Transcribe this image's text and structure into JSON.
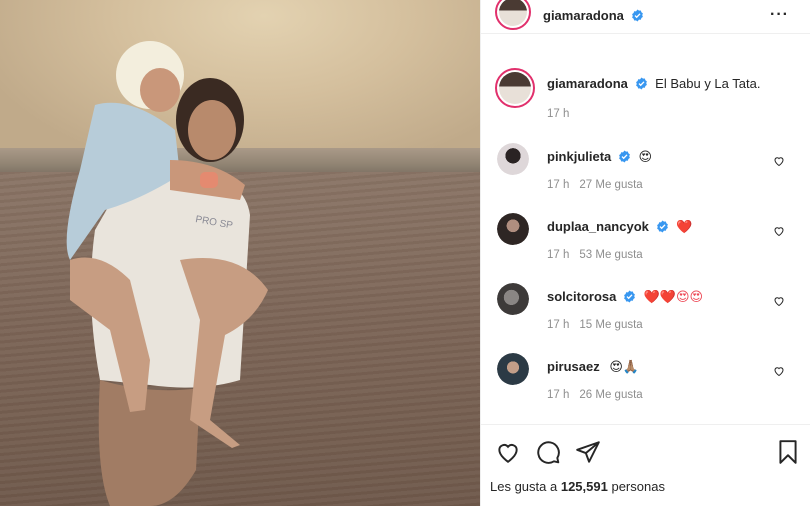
{
  "post": {
    "author": "giamaradona",
    "caption": "El Babu y La Tata.",
    "time": "17 h"
  },
  "comments": [
    {
      "user": "pinkjulieta",
      "text": "😍",
      "time": "17 h",
      "likes": "27 Me gusta"
    },
    {
      "user": "duplaa_nancyok",
      "text": "❤️",
      "time": "17 h",
      "likes": "53 Me gusta"
    },
    {
      "user": "solcitorosa",
      "text": "❤️❤️😍😍",
      "time": "17 h",
      "likes": "15 Me gusta"
    },
    {
      "user": "pirusaez",
      "text": "😍🙏🏽",
      "time": "17 h",
      "likes": "26 Me gusta"
    }
  ],
  "likes": {
    "prefix": "Les gusta a",
    "count": "125,591",
    "suffix": "personas"
  },
  "icons": {
    "more": "more-options-icon",
    "verified": "verified-badge-icon",
    "like": "heart-icon",
    "comment": "comment-icon",
    "share": "share-icon",
    "save": "bookmark-icon"
  },
  "colors": {
    "verified": "#3897f0",
    "heart_red": "#ed4956",
    "muted": "#8e8e8e",
    "story_ring": "#e1306c"
  }
}
